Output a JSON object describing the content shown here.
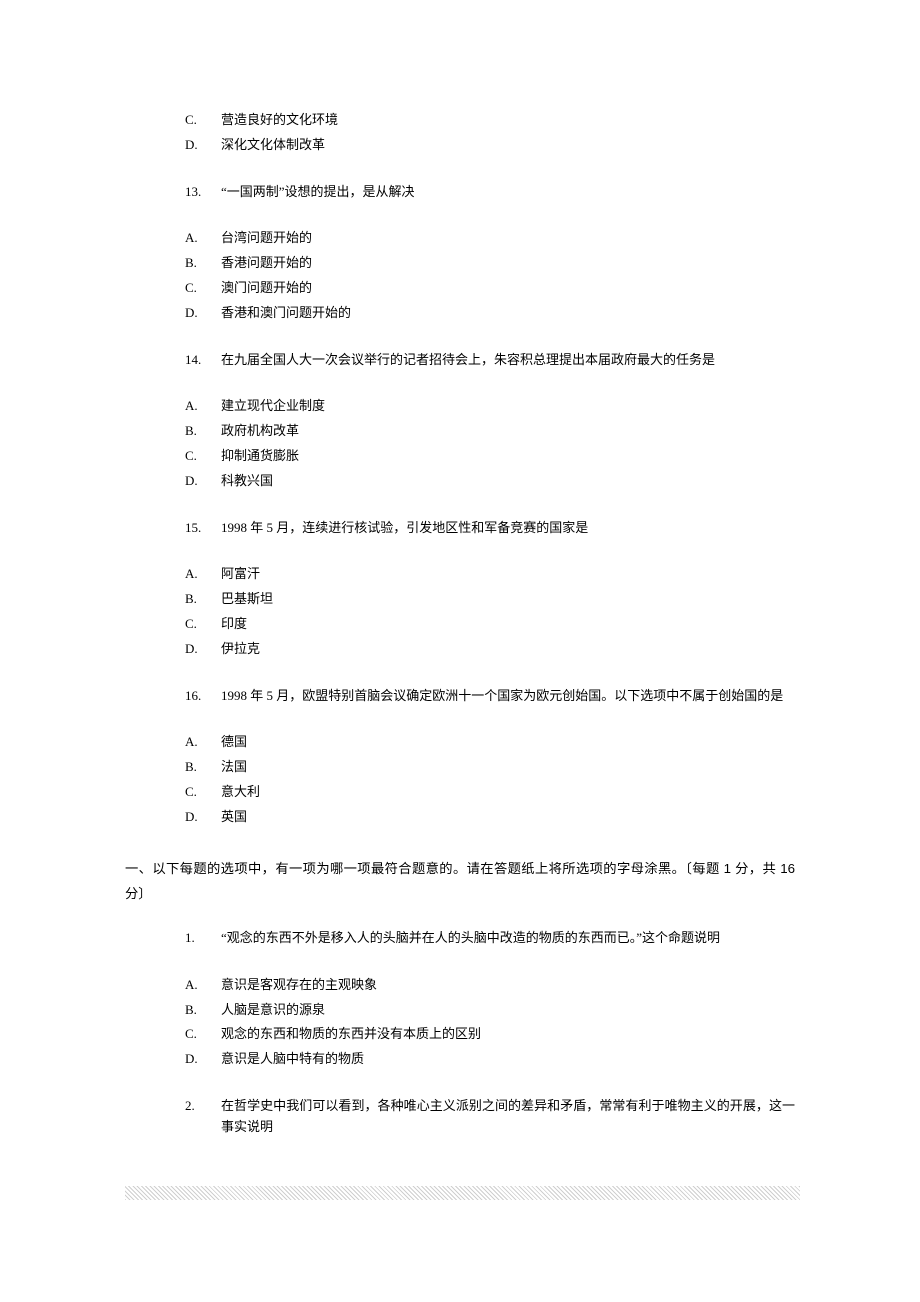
{
  "top_opts": [
    {
      "letter": "C.",
      "text": "营造良好的文化环境"
    },
    {
      "letter": "D.",
      "text": "深化文化体制改革"
    }
  ],
  "questions_part1": [
    {
      "num": "13.",
      "stem": "“一国两制”设想的提出，是从解决",
      "opts": [
        {
          "letter": "A.",
          "text": "台湾问题开始的"
        },
        {
          "letter": "B.",
          "text": "香港问题开始的"
        },
        {
          "letter": "C.",
          "text": "澳门问题开始的"
        },
        {
          "letter": "D.",
          "text": "香港和澳门问题开始的"
        }
      ]
    },
    {
      "num": "14.",
      "stem": "在九届全国人大一次会议举行的记者招待会上，朱容积总理提出本届政府最大的任务是",
      "opts": [
        {
          "letter": "A.",
          "text": "建立现代企业制度"
        },
        {
          "letter": "B.",
          "text": "政府机构改革"
        },
        {
          "letter": "C.",
          "text": "抑制通货膨胀"
        },
        {
          "letter": "D.",
          "text": "科教兴国"
        }
      ]
    },
    {
      "num": "15.",
      "stem": "1998 年 5 月，连续进行核试验，引发地区性和军备竞赛的国家是",
      "opts": [
        {
          "letter": "A.",
          "text": "阿富汗"
        },
        {
          "letter": "B.",
          "text": "巴基斯坦"
        },
        {
          "letter": "C.",
          "text": "印度"
        },
        {
          "letter": "D.",
          "text": "伊拉克"
        }
      ]
    },
    {
      "num": "16.",
      "stem": "1998 年 5 月，欧盟特别首脑会议确定欧洲十一个国家为欧元创始国。以下选项中不属于创始国的是",
      "opts": [
        {
          "letter": "A.",
          "text": "德国"
        },
        {
          "letter": "B.",
          "text": "法国"
        },
        {
          "letter": "C.",
          "text": "意大利"
        },
        {
          "letter": "D.",
          "text": "英国"
        }
      ]
    }
  ],
  "section_heading": "一、以下每题的选项中，有一项为哪一项最符合题意的。请在答题纸上将所选项的字母涂黑。〔每题 1 分，共 16 分〕",
  "questions_part2": [
    {
      "num": "1.",
      "stem": "“观念的东西不外是移入人的头脑并在人的头脑中改造的物质的东西而已。”这个命题说明",
      "opts": [
        {
          "letter": "A.",
          "text": "意识是客观存在的主观映象"
        },
        {
          "letter": "B.",
          "text": "人脑是意识的源泉"
        },
        {
          "letter": "C.",
          "text": "观念的东西和物质的东西并没有本质上的区别"
        },
        {
          "letter": "D.",
          "text": "意识是人脑中特有的物质"
        }
      ]
    },
    {
      "num": "2.",
      "stem": "在哲学史中我们可以看到，各种唯心主义派别之间的差异和矛盾，常常有利于唯物主义的开展，这一事实说明",
      "opts": []
    }
  ]
}
